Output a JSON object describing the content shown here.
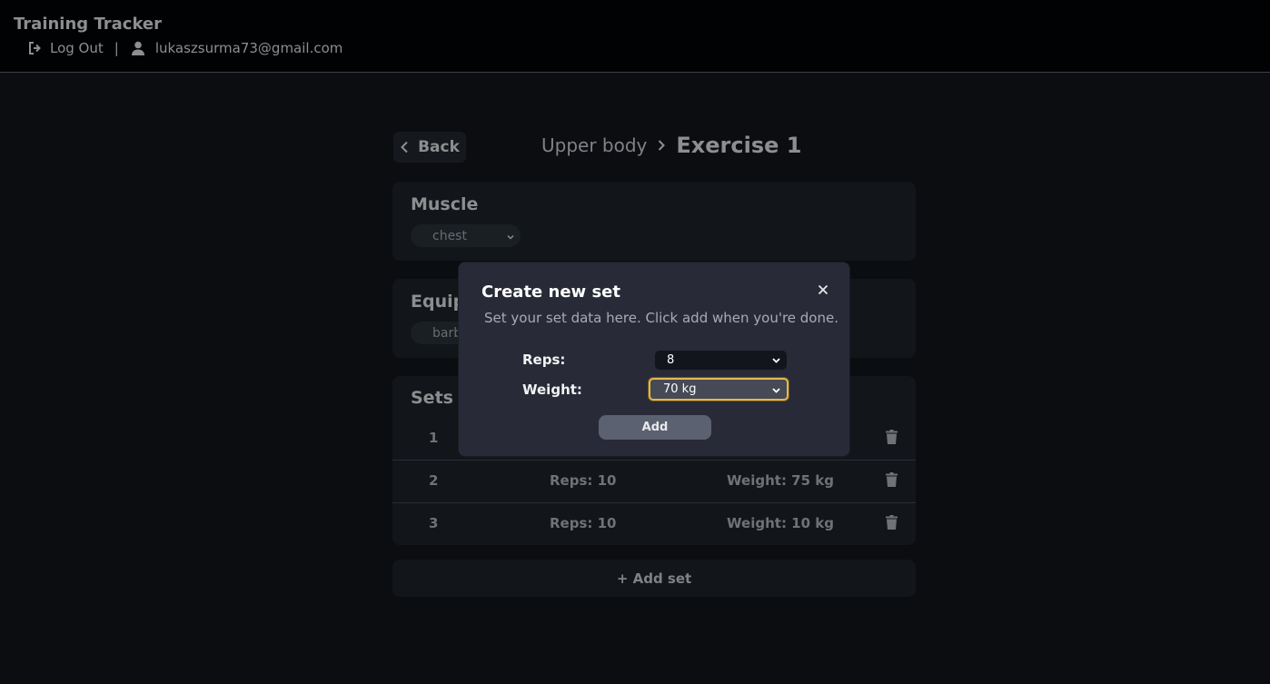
{
  "app": {
    "title": "Training Tracker",
    "logout_label": "Log Out",
    "separator": "|",
    "user_email": "lukaszsurma73@gmail.com"
  },
  "header": {
    "back_label": "Back",
    "breadcrumb_parent": "Upper body",
    "breadcrumb_current": "Exercise 1"
  },
  "muscle": {
    "title": "Muscle",
    "selected": "chest"
  },
  "equipment": {
    "title": "Equip",
    "selected": "barb"
  },
  "sets": {
    "title": "Sets",
    "rows": [
      {
        "number": "1",
        "reps": "",
        "weight": ""
      },
      {
        "number": "2",
        "reps": "Reps: 10",
        "weight": "Weight: 75 kg"
      },
      {
        "number": "3",
        "reps": "Reps: 10",
        "weight": "Weight: 10 kg"
      }
    ],
    "add_label": "+ Add set"
  },
  "modal": {
    "title": "Create new set",
    "description": "Set your set data here. Click add when you're done.",
    "reps_label": "Reps:",
    "reps_value": "8",
    "weight_label": "Weight:",
    "weight_value": "70 kg",
    "add_label": "Add",
    "close_icon": "close-icon"
  },
  "colors": {
    "focus_ring": "#e6b84a",
    "modal_bg": "#282a37",
    "page_bg": "#0b0d11"
  }
}
